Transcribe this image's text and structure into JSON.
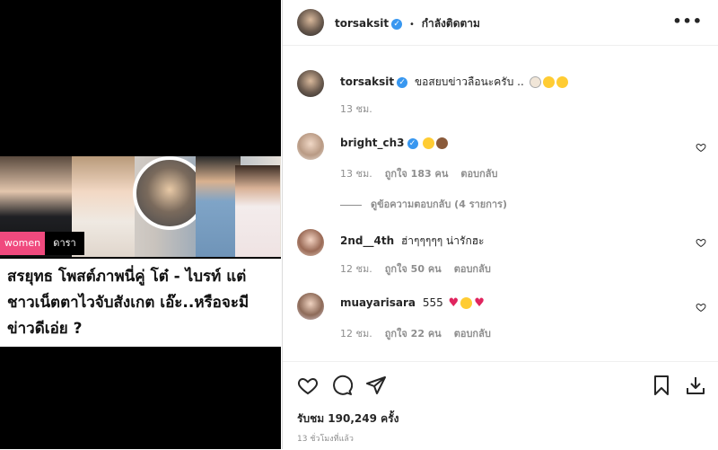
{
  "media": {
    "tag_women": "women",
    "tag_category": "ดารา",
    "article_title": "สรยุทธ โพสต์ภาพนี่คู่ โต๋ - ไบรท์ แต่ ชาวเน็ตตาไวจับสังเกต เอ๊ะ..หรือจะมีข่าวดีเอ่ย ?"
  },
  "header": {
    "username": "torsaksit",
    "separator": "•",
    "follow_status": "กำลังติดตาม",
    "more_icon": "more-horizontal-icon"
  },
  "caption": {
    "username": "torsaksit",
    "text": "ขอสยบข่าวลือนะครับ ..",
    "time": "13 ชม."
  },
  "comments": [
    {
      "username": "bright_ch3",
      "text": "",
      "time": "13 ชม.",
      "likes": "ถูกใจ 183 คน",
      "reply": "ตอบกลับ",
      "view_replies": "ดูข้อความตอบกลับ (4 รายการ)"
    },
    {
      "username": "2nd__4th",
      "text": "ฮ่าๆๆๆๆๆ น่ารักฮะ",
      "time": "12 ชม.",
      "likes": "ถูกใจ 50 คน",
      "reply": "ตอบกลับ"
    },
    {
      "username": "muayarisara",
      "text": "555",
      "time": "12 ชม.",
      "likes": "ถูกใจ 22 คน",
      "reply": "ตอบกลับ"
    }
  ],
  "footer": {
    "likes_text": "รับชม 190,249 ครั้ง",
    "timestamp": "13 ชั่วโมงที่แล้ว"
  },
  "colors": {
    "verified": "#3897f0",
    "tag_women": "#f04a7e",
    "muted": "#8e8e8e"
  }
}
